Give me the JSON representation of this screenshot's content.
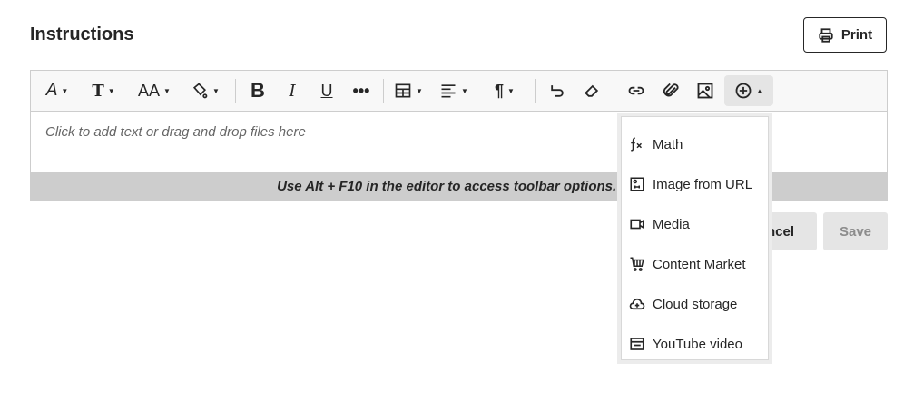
{
  "header": {
    "title": "Instructions",
    "print_label": "Print"
  },
  "toolbar": {
    "items": [
      {
        "icon": "text-style-icon",
        "dropdown": true
      },
      {
        "icon": "font-family-icon",
        "dropdown": true
      },
      {
        "icon": "font-size-icon",
        "dropdown": true
      },
      {
        "icon": "highlight-color-icon",
        "dropdown": true
      },
      {
        "icon": "bold-icon"
      },
      {
        "icon": "italic-icon"
      },
      {
        "icon": "underline-icon"
      },
      {
        "icon": "more-icon"
      },
      {
        "icon": "table-icon",
        "dropdown": true
      },
      {
        "icon": "align-icon",
        "dropdown": true
      },
      {
        "icon": "paragraph-icon",
        "dropdown": true
      },
      {
        "icon": "undo-icon"
      },
      {
        "icon": "eraser-icon"
      },
      {
        "icon": "link-icon"
      },
      {
        "icon": "attach-icon"
      },
      {
        "icon": "image-icon"
      },
      {
        "icon": "insert-content-icon",
        "dropdown": true,
        "active": true
      }
    ]
  },
  "editor": {
    "placeholder": "Click to add text or drag and drop files here",
    "hint": "Use Alt + F10 in the editor to access toolbar options. Use Escape to"
  },
  "actions": {
    "cancel_label": "ncel",
    "save_label": "Save"
  },
  "insert_menu": {
    "items": [
      {
        "label": "Math",
        "icon": "math-icon"
      },
      {
        "label": "Image from URL",
        "icon": "image-url-icon"
      },
      {
        "label": "Media",
        "icon": "media-icon"
      },
      {
        "label": "Content Market",
        "icon": "cart-icon"
      },
      {
        "label": "Cloud storage",
        "icon": "cloud-storage-icon"
      },
      {
        "label": "YouTube video",
        "icon": "youtube-icon"
      }
    ]
  }
}
